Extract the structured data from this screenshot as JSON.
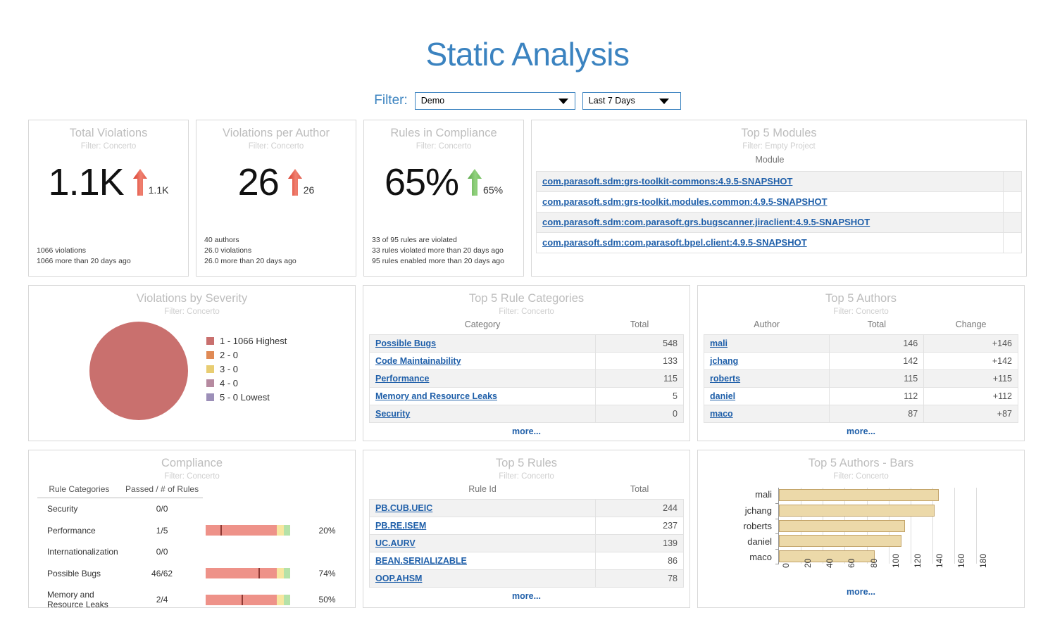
{
  "header": {
    "title": "Static Analysis",
    "filter_label": "Filter:",
    "project_filter": {
      "value": "Demo"
    },
    "range_filter": {
      "value": "Last 7 Days"
    }
  },
  "widgets": {
    "total_violations": {
      "title": "Total Violations",
      "subtitle": "Filter: Concerto",
      "value": "1.1K",
      "delta": "1.1K",
      "trend": "up",
      "trend_color": "#e8564a",
      "notes": [
        "1066 violations",
        "1066 more than 20 days ago"
      ]
    },
    "violations_per_author": {
      "title": "Violations per Author",
      "subtitle": "Filter: Concerto",
      "value": "26",
      "delta": "26",
      "trend": "up",
      "trend_color": "#e8564a",
      "notes": [
        "40 authors",
        "26.0 violations",
        "26.0 more than 20 days ago"
      ]
    },
    "rules_in_compliance": {
      "title": "Rules in Compliance",
      "subtitle": "Filter: Concerto",
      "value": "65%",
      "delta": "65%",
      "trend": "up",
      "trend_color": "#6fbf5b",
      "notes": [
        "33 of 95 rules are violated",
        "33 rules violated more than 20 days ago",
        "95 rules enabled more than 20 days ago"
      ]
    },
    "top_modules": {
      "title": "Top 5 Modules",
      "subtitle": "Filter: Empty Project",
      "column": "Module",
      "rows": [
        "com.parasoft.sdm:grs-toolkit-commons:4.9.5-SNAPSHOT",
        "com.parasoft.sdm:grs-toolkit.modules.common:4.9.5-SNAPSHOT",
        "com.parasoft.sdm:com.parasoft.grs.bugscanner.jiraclient:4.9.5-SNAPSHOT",
        "com.parasoft.sdm:com.parasoft.bpel.client:4.9.5-SNAPSHOT"
      ]
    },
    "violations_by_severity": {
      "title": "Violations by Severity",
      "subtitle": "Filter: Concerto"
    },
    "top_rule_categories": {
      "title": "Top 5 Rule Categories",
      "subtitle": "Filter: Concerto",
      "columns": [
        "Category",
        "Total"
      ],
      "rows": [
        {
          "category": "Possible Bugs",
          "total": "548"
        },
        {
          "category": "Code Maintainability",
          "total": "133"
        },
        {
          "category": "Performance",
          "total": "115"
        },
        {
          "category": "Memory and Resource Leaks",
          "total": "5"
        },
        {
          "category": "Security",
          "total": "0"
        }
      ],
      "more_label": "more..."
    },
    "top_authors": {
      "title": "Top 5 Authors",
      "subtitle": "Filter: Concerto",
      "columns": [
        "Author",
        "Total",
        "Change"
      ],
      "rows": [
        {
          "author": "mali",
          "total": "146",
          "change": "+146"
        },
        {
          "author": "jchang",
          "total": "142",
          "change": "+142"
        },
        {
          "author": "roberts",
          "total": "115",
          "change": "+115"
        },
        {
          "author": "daniel",
          "total": "112",
          "change": "+112"
        },
        {
          "author": "maco",
          "total": "87",
          "change": "+87"
        }
      ],
      "more_label": "more..."
    },
    "compliance": {
      "title": "Compliance",
      "subtitle": "Filter: Concerto",
      "columns": [
        "Rule Categories",
        "Passed / # of Rules"
      ],
      "rows": [
        {
          "name": "Security",
          "ratio": "0/0",
          "pct": "",
          "pct_value": null
        },
        {
          "name": "Performance",
          "ratio": "1/5",
          "pct": "20%",
          "pct_value": 20
        },
        {
          "name": "Internationalization",
          "ratio": "0/0",
          "pct": "",
          "pct_value": null
        },
        {
          "name": "Possible Bugs",
          "ratio": "46/62",
          "pct": "74%",
          "pct_value": 74
        },
        {
          "name": "Memory and Resource Leaks",
          "ratio": "2/4",
          "pct": "50%",
          "pct_value": 50
        }
      ]
    },
    "top_rules": {
      "title": "Top 5 Rules",
      "subtitle": "Filter: Concerto",
      "columns": [
        "Rule Id",
        "Total"
      ],
      "rows": [
        {
          "rule": "PB.CUB.UEIC",
          "total": "244"
        },
        {
          "rule": "PB.RE.ISEM",
          "total": "237"
        },
        {
          "rule": "UC.AURV",
          "total": "139"
        },
        {
          "rule": "BEAN.SERIALIZABLE",
          "total": "86"
        },
        {
          "rule": "OOP.AHSM",
          "total": "78"
        }
      ],
      "more_label": "more..."
    },
    "top_authors_bars": {
      "title": "Top 5 Authors - Bars",
      "subtitle": "Filter: Concerto",
      "more_label": "more..."
    }
  },
  "chart_data": [
    {
      "type": "pie",
      "title": "Violations by Severity",
      "subtitle": "Filter: Concerto",
      "legend_position": "right",
      "labels": [
        "1 - 1066 Highest",
        "2 - 0",
        "3 - 0",
        "4 - 0",
        "5 - 0 Lowest"
      ],
      "values": [
        1066,
        0,
        0,
        0,
        0
      ],
      "colors": [
        "#c9706e",
        "#e08a55",
        "#e8cd72",
        "#b68aa0",
        "#9c8fb8"
      ]
    },
    {
      "type": "bar",
      "orientation": "horizontal",
      "title": "Top 5 Authors - Bars",
      "subtitle": "Filter: Concerto",
      "categories": [
        "mali",
        "jchang",
        "roberts",
        "daniel",
        "maco"
      ],
      "values": [
        146,
        142,
        115,
        112,
        87
      ],
      "xlabel": "",
      "ylabel": "",
      "xlim": [
        0,
        190
      ],
      "ticks": [
        "0",
        "20",
        "40",
        "60",
        "80",
        "100",
        "120",
        "140",
        "160",
        "180"
      ],
      "grid": true,
      "bar_color": "#ecd9a9",
      "bar_border": "#c2a368"
    }
  ]
}
